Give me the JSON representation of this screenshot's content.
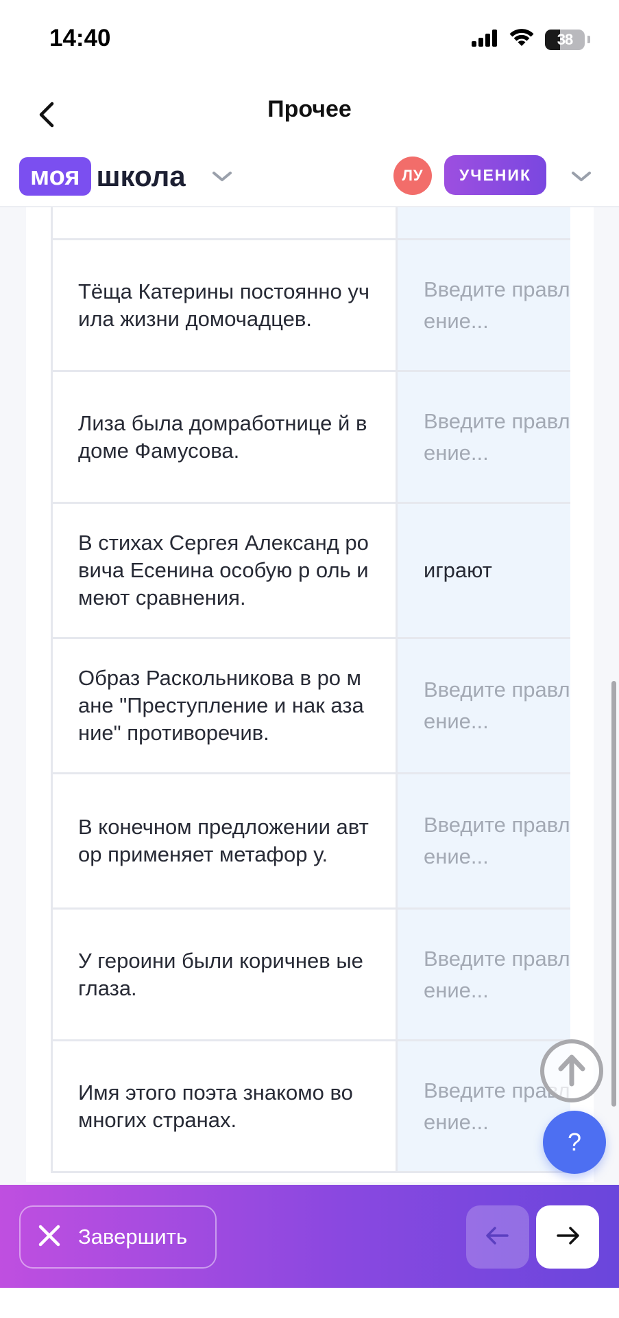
{
  "status_bar": {
    "time": "14:40",
    "battery_percent": "38",
    "battery_level": 0.38
  },
  "header": {
    "title": "Прочее"
  },
  "brand": {
    "logo_box": "моя",
    "logo_text": "школа"
  },
  "user": {
    "initials": "ЛУ",
    "role": "УЧЕНИК"
  },
  "table": {
    "rows": [
      {
        "text": "",
        "answer": "",
        "placeholder": ""
      },
      {
        "text": "Тёща Катерины постоянно учила жизни домочадцев.",
        "answer": "",
        "placeholder": "Введите правление..."
      },
      {
        "text": "Лиза была домработнице й в доме Фамусова.",
        "answer": "",
        "placeholder": "Введите правление..."
      },
      {
        "text": "В стихах Сергея Александ ровича Есенина особую р оль имеют сравнения.",
        "answer": "играют",
        "placeholder": ""
      },
      {
        "text": "Образ Раскольникова в ро мане \"Преступление и нак азание\" противоречив.",
        "answer": "",
        "placeholder": "Введите правление..."
      },
      {
        "text": "В конечном предложении автор применяет метафор у.",
        "answer": "",
        "placeholder": "Введите правление..."
      },
      {
        "text": "У героини были коричнев ые глаза.",
        "answer": "",
        "placeholder": "Введите правление..."
      },
      {
        "text": "Имя этого поэта знакомо во многих странах.",
        "answer": "",
        "placeholder": "Введите правление..."
      }
    ]
  },
  "help": {
    "label": "?"
  },
  "footer": {
    "finish_label": "Завершить"
  },
  "colors": {
    "brand": "#7b4ff0",
    "avatar": "#f26d6a",
    "help": "#4d6ff2",
    "answer_cell": "#eef5fd"
  }
}
